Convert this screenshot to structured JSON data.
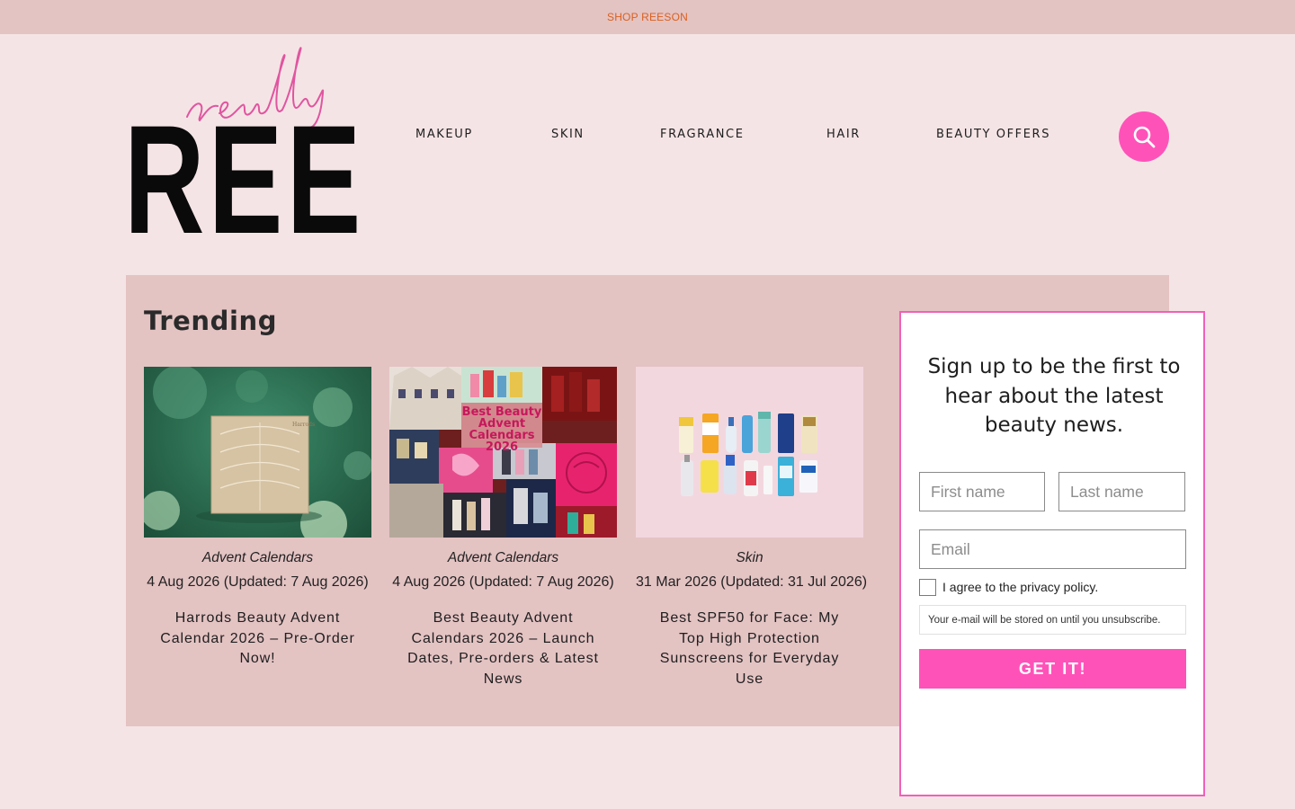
{
  "topbar": {
    "link_label": "SHOP REESON"
  },
  "logo": {
    "script_text": "really",
    "main_text": "REE"
  },
  "nav": {
    "items": [
      {
        "label": "MAKEUP"
      },
      {
        "label": "SKIN"
      },
      {
        "label": "FRAGRANCE"
      },
      {
        "label": "HAIR"
      },
      {
        "label": "BEAUTY OFFERS"
      }
    ],
    "search_icon": "search-icon"
  },
  "trending": {
    "title": "Trending",
    "cards": [
      {
        "category": "Advent Calendars",
        "date": "4 Aug 2026 (Updated: 7 Aug 2026)",
        "title": "Harrods Beauty Advent Calendar 2026 – Pre-Order Now!",
        "image_text": ""
      },
      {
        "category": "Advent Calendars",
        "date": "4 Aug 2026 (Updated: 7 Aug 2026)",
        "title": "Best Beauty Advent Calendars 2026 – Launch Dates, Pre-orders & Latest News",
        "image_text": "Best Beauty Advent Calendars 2026"
      },
      {
        "category": "Skin",
        "date": "31 Mar 2026 (Updated: 31 Jul 2026)",
        "title": "Best SPF50 for Face: My Top High Protection Sunscreens for Everyday Use",
        "image_text": ""
      }
    ]
  },
  "signup": {
    "heading": "Sign up to be the first to hear about the latest beauty news.",
    "first_name_placeholder": "First name",
    "last_name_placeholder": "Last name",
    "email_placeholder": "Email",
    "privacy_label": "I agree to the privacy policy.",
    "storage_note": "Your e-mail will be stored on until you unsubscribe.",
    "button_label": "GET IT!"
  },
  "colors": {
    "accent_pink": "#ff52b9",
    "topbar_bg": "#e4c3c3",
    "page_bg": "#f5e4e6",
    "topbar_link": "#d9611f"
  }
}
